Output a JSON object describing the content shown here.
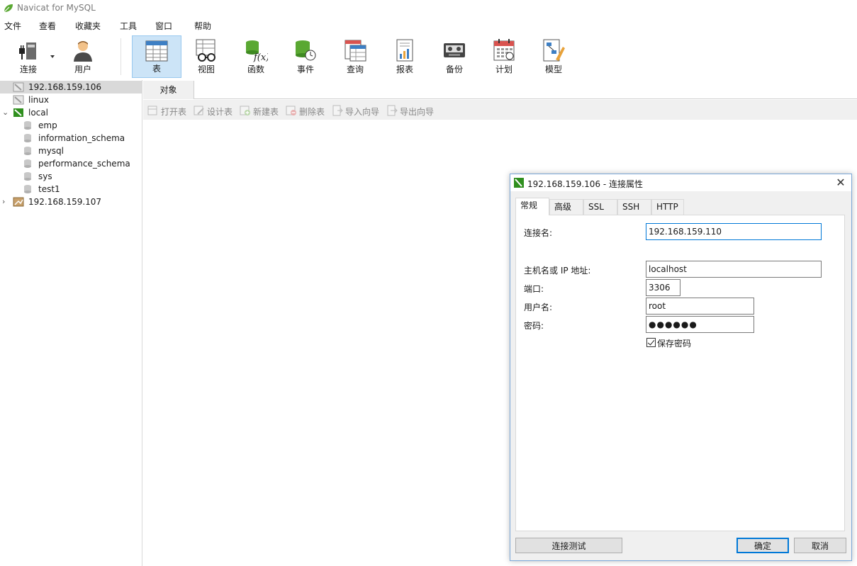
{
  "window": {
    "title": "Navicat for MySQL"
  },
  "menu": [
    "文件",
    "查看",
    "收藏夹",
    "工具",
    "窗口",
    "帮助"
  ],
  "toolbar": {
    "connect": "连接",
    "user": "用户",
    "items": [
      "表",
      "视图",
      "函数",
      "事件",
      "查询",
      "报表",
      "备份",
      "计划",
      "模型"
    ],
    "active": "表"
  },
  "sidebar": {
    "items": [
      {
        "label": "192.168.159.106",
        "selected": true
      },
      {
        "label": "linux"
      },
      {
        "label": "local",
        "expanded": true
      },
      {
        "label": "emp"
      },
      {
        "label": "information_schema"
      },
      {
        "label": "mysql"
      },
      {
        "label": "performance_schema"
      },
      {
        "label": "sys"
      },
      {
        "label": "test1"
      },
      {
        "label": "192.168.159.107"
      }
    ]
  },
  "object_tab": "对象",
  "object_toolbar": [
    "打开表",
    "设计表",
    "新建表",
    "删除表",
    "导入向导",
    "导出向导"
  ],
  "dialog": {
    "title": "192.168.159.106 - 连接属性",
    "tabs": [
      "常规",
      "高级",
      "SSL",
      "SSH",
      "HTTP"
    ],
    "active_tab": "常规",
    "fields": {
      "conn_name": {
        "label": "连接名:",
        "value": "192.168.159.110"
      },
      "host": {
        "label": "主机名或 IP 地址:",
        "value": "localhost"
      },
      "port": {
        "label": "端口:",
        "value": "3306"
      },
      "username": {
        "label": "用户名:",
        "value": "root"
      },
      "password": {
        "label": "密码:",
        "value": "●●●●●●"
      }
    },
    "save_password": {
      "label": "保存密码",
      "checked": true
    },
    "buttons": {
      "test": "连接测试",
      "ok": "确定",
      "cancel": "取消"
    }
  },
  "colors": {
    "accent": "#0078d7",
    "active_toolbar": "#cce4f7",
    "selection": "#d9d9d9"
  }
}
